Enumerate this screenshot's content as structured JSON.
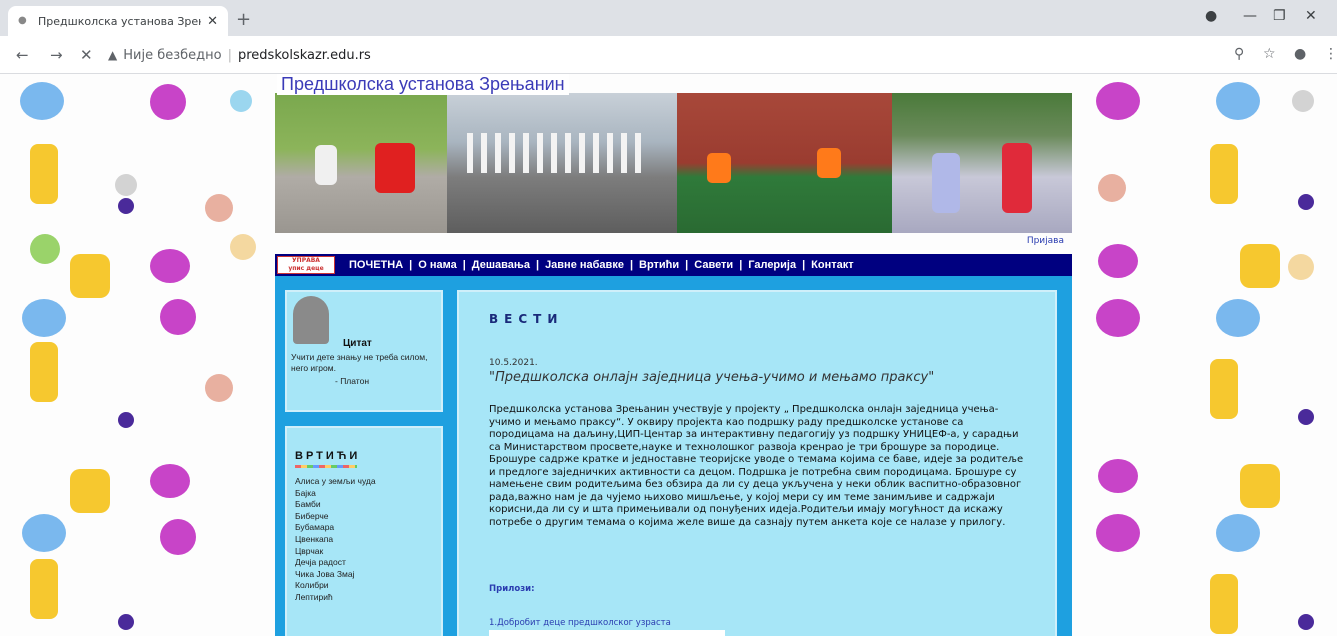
{
  "browser": {
    "tab_title": "Предшколска установа Зрењан",
    "url_security": "Није безбедно",
    "url": "predskolskazr.edu.rs"
  },
  "site": {
    "title": "Предшколска установа Зрењанин",
    "login": "Пријава",
    "menu": [
      "ПОЧЕТНА",
      "О нама",
      "Дешавања",
      "Јавне набавке",
      "Вртићи",
      "Савети",
      "Галерија",
      "Контакт"
    ],
    "quote": {
      "heading": "Цитат",
      "text": "Учити дете знању не треба силом, него игром.",
      "author": "- Платон"
    },
    "kindergartens": {
      "heading": "ВРТИЋИ",
      "items": [
        "Алиса у земљи чуда",
        "Бајка",
        "Бамби",
        "Биберче",
        "Бубамара",
        "Цвенкапа",
        "Цврчак",
        "Дечја радост",
        "Чика Јова Змај",
        "Колибри",
        "Лептирић"
      ]
    },
    "news": {
      "heading": "ВЕСТИ",
      "date": "10.5.2021.",
      "title": "\"Предшколска онлајн заједница учења-учимо и мењамо праксу\"",
      "body": "Предшколска установа Зрењанин учествује у пројекту „ Предшколска онлајн заједница учења-учимо и мењамо праксу“. У оквиру пројекта као подршку раду предшколске установе са породицама на даљину,ЦИП-Центар за интерактивну педагогију уз подршку УНИЦЕФ-а, у сарадњи са Министарством просвете,науке и технолошког развоја кренрао је три брошуре за породице. Брошуре садрже кратке и једноставне теоријске уводе о темама којима се баве, идеје за родитеље и предлоге заједничких активности са децом. Подршка је потребна свим породицама. Брошуре су намењене свим родитељима без обзира да ли су деца укључена у неки облик васпитно-образовног рада,важно нам је да чујемо њихово мишљење, у којој мери су им теме занимљиве и садржаји корисни,да ли су и шта примењивали од понуђених идеја.Родитељи имају могућност да искажу потребе о другим темама о којима желе више да сазнају путем анкета које се налазе у прилогу.",
      "attachments_label": "Прилози:",
      "attachment_1": "1.Добробит деце предшколског узраста"
    }
  }
}
